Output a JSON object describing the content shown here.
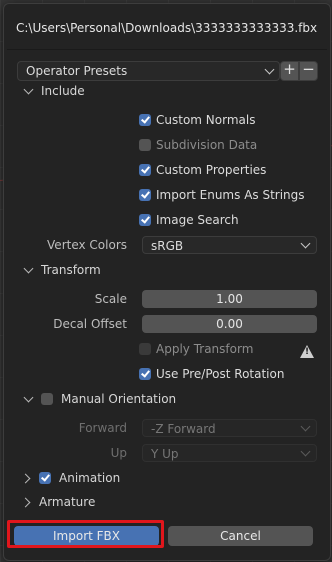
{
  "dialog": {
    "title": "C:\\Users\\Personal\\Downloads\\3333333333333.fbx"
  },
  "presets": {
    "label": "Operator Presets",
    "add_label": "+",
    "remove_label": "−"
  },
  "include": {
    "header": "Include",
    "options": [
      {
        "label": "Custom Normals",
        "checked": true,
        "enabled": true
      },
      {
        "label": "Subdivision Data",
        "checked": false,
        "enabled": true
      },
      {
        "label": "Custom Properties",
        "checked": true,
        "enabled": true
      },
      {
        "label": "Import Enums As Strings",
        "checked": true,
        "enabled": true
      },
      {
        "label": "Image Search",
        "checked": true,
        "enabled": true
      }
    ],
    "vertex_colors_label": "Vertex Colors",
    "vertex_colors_value": "sRGB"
  },
  "transform": {
    "header": "Transform",
    "scale_label": "Scale",
    "scale_value": "1.00",
    "decal_offset_label": "Decal Offset",
    "decal_offset_value": "0.00",
    "apply_transform_label": "Apply Transform",
    "apply_transform_checked": false,
    "use_prepost_label": "Use Pre/Post Rotation",
    "use_prepost_checked": true
  },
  "manual_orientation": {
    "header": "Manual Orientation",
    "checked": false,
    "forward_label": "Forward",
    "forward_value": "-Z Forward",
    "up_label": "Up",
    "up_value": "Y Up"
  },
  "animation": {
    "header": "Animation",
    "checked": true
  },
  "armature": {
    "header": "Armature"
  },
  "buttons": {
    "import_label": "Import FBX",
    "cancel_label": "Cancel"
  },
  "colors": {
    "accent": "#4772b3",
    "highlight": "#e0161c",
    "panel": "#232323"
  }
}
